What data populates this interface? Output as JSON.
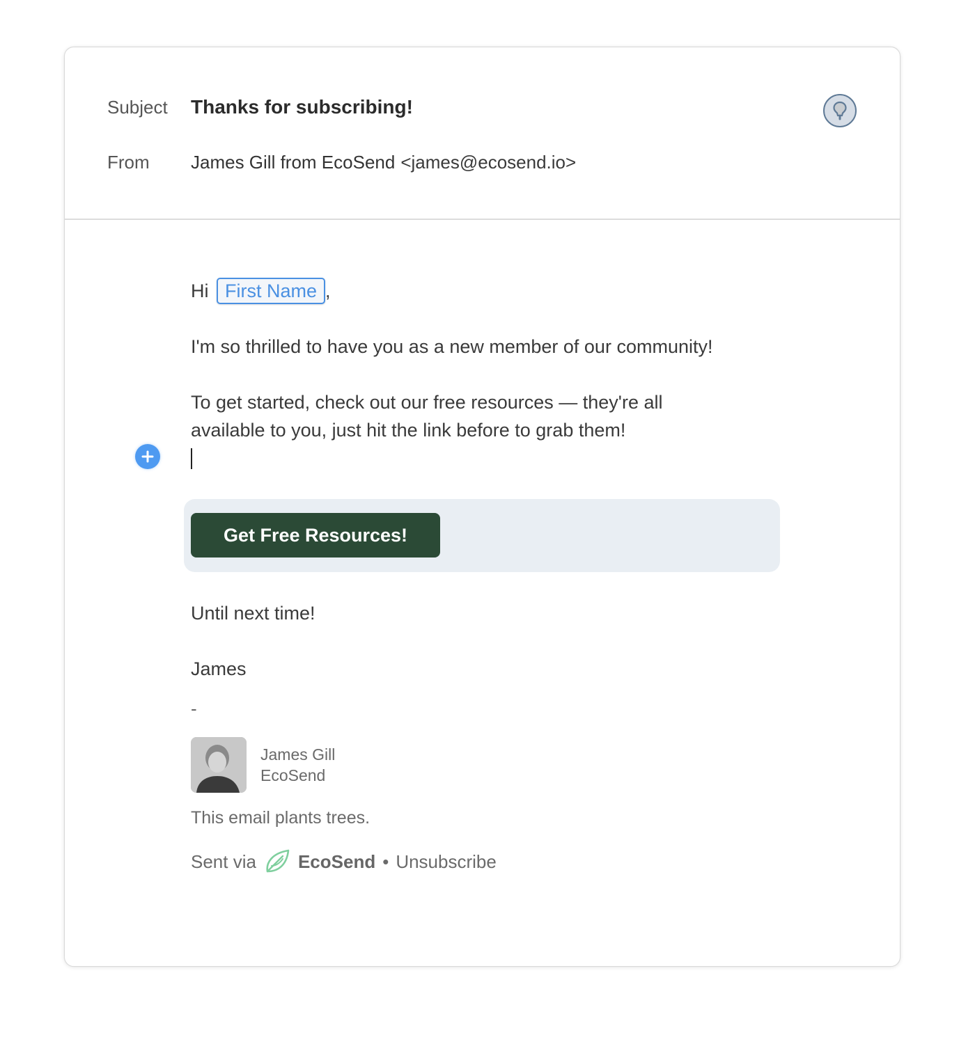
{
  "header": {
    "subject_label": "Subject",
    "subject_value": "Thanks for subscribing!",
    "from_label": "From",
    "from_name": "James Gill from EcoSend",
    "from_email": "<james@ecosend.io>",
    "tip_icon": "lightbulb-icon"
  },
  "body": {
    "greeting_prefix": "Hi",
    "merge_tag": "First Name",
    "greeting_suffix": ",",
    "paragraph1": "I'm so thrilled to have you as a new member of our community!",
    "paragraph2": "To get started, check out our free resources — they're all available to you, just hit the link before to grab them!",
    "add_block_icon": "plus-icon",
    "cta_label": "Get Free Resources!",
    "closing": "Until next time!",
    "signoff": "James",
    "separator": "-"
  },
  "signature": {
    "name": "James Gill",
    "company": "EcoSend"
  },
  "footer": {
    "trees_text": "This email plants trees.",
    "sent_via": "Sent via",
    "brand": "EcoSend",
    "bullet": "•",
    "unsubscribe": "Unsubscribe"
  },
  "colors": {
    "cta_bg": "#2b4a36",
    "merge_tag": "#4a90e2",
    "add_button": "#4e9af1",
    "leaf": "#7fcf9e"
  }
}
